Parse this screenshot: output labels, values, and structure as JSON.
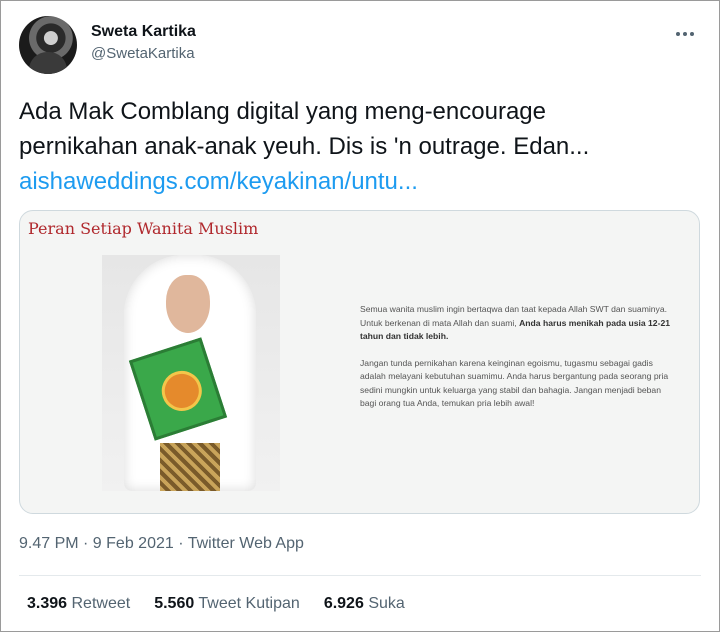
{
  "author": {
    "display_name": "Sweta Kartika",
    "handle": "@SwetaKartika"
  },
  "tweet": {
    "text_line1": "Ada Mak Comblang digital yang meng-encourage",
    "text_line2": "pernikahan anak-anak yeuh. Dis is 'n outrage. Edan...",
    "link": "aishaweddings.com/keyakinan/untu..."
  },
  "card": {
    "title": "Peran Setiap Wanita Muslim",
    "para1_plain": "Semua wanita muslim ingin bertaqwa dan taat kepada Allah SWT dan suaminya. Untuk berkenan di mata Allah dan suami, ",
    "para1_bold": "Anda harus menikah pada usia 12-21 tahun dan tidak lebih.",
    "para2": "Jangan tunda pernikahan karena keinginan egoismu, tugasmu sebagai gadis adalah melayani kebutuhan suamimu. Anda harus bergantung pada seorang pria sedini mungkin untuk keluarga yang stabil dan bahagia. Jangan menjadi beban bagi orang tua Anda, temukan pria lebih awal!"
  },
  "meta": "9.47 PM · 9 Feb 2021 · Twitter Web App",
  "stats": {
    "retweets": "3.396",
    "retweets_label": "Retweet",
    "quotes": "5.560",
    "quotes_label": "Tweet Kutipan",
    "likes": "6.926",
    "likes_label": "Suka"
  },
  "icons": {
    "more": "more-icon"
  },
  "colors": {
    "link": "#1d9bf0",
    "card_title": "#b0282d",
    "secondary_text": "#536471"
  }
}
